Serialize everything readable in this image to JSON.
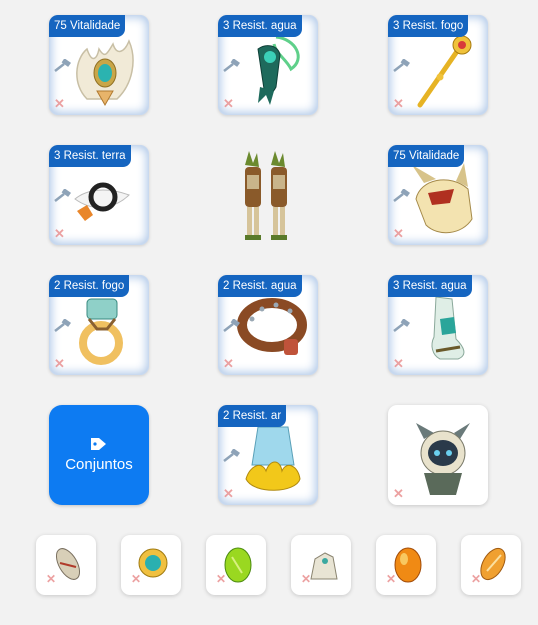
{
  "slots": [
    {
      "name": "amulet-slot",
      "badge": "75 Vitalidade"
    },
    {
      "name": "shield-slot",
      "badge": "3 Resist. agua"
    },
    {
      "name": "weapon-slot",
      "badge": "3 Resist. fogo"
    },
    {
      "name": "ring-left-slot",
      "badge": "3 Resist. terra"
    },
    {
      "name": "hat-slot",
      "badge": "75 Vitalidade"
    },
    {
      "name": "ring-right-slot",
      "badge": "2 Resist. fogo"
    },
    {
      "name": "belt-slot",
      "badge": "2 Resist. agua"
    },
    {
      "name": "boots-slot",
      "badge": "3 Resist. agua"
    },
    {
      "name": "cape-slot",
      "badge": "2 Resist. ar"
    }
  ],
  "sets_button": {
    "label": "Conjuntos"
  },
  "icons": {
    "remove": "x-mark-icon",
    "forge": "hammer-icon",
    "tag": "tag-icon"
  },
  "colors": {
    "badge": "#1565c0",
    "button": "#0d7bf2",
    "slot_glow": "#a9c4e6",
    "remove": "#e88a8a"
  },
  "dofus_slots": [
    "dofus-slot-1",
    "dofus-slot-2",
    "dofus-slot-3",
    "dofus-slot-4",
    "dofus-slot-5",
    "dofus-slot-6"
  ]
}
